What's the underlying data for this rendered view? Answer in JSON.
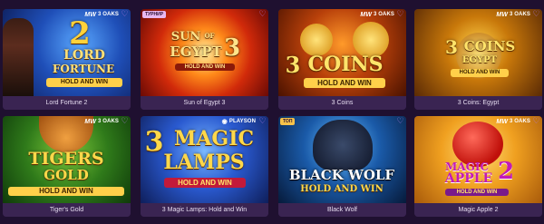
{
  "games": [
    {
      "label": "Lord Fortune 2",
      "logo_lines": [
        "2",
        "LORD",
        "FORTUNE",
        "HOLD AND WIN"
      ],
      "provider": {
        "mark": "MW",
        "name": "3 OAKS",
        "sub": "GAMING"
      },
      "favorite_icon": "heart-icon"
    },
    {
      "label": "Sun of Egypt 3",
      "logo_lines": [
        "SUN",
        "OF",
        "EGYPT",
        "3",
        "HOLD AND WIN"
      ],
      "tag": "ТУРНИР",
      "favorite_icon": "heart-icon"
    },
    {
      "label": "3 Coins",
      "logo_lines": [
        "3",
        "COINS",
        "HOLD AND WIN"
      ],
      "provider": {
        "mark": "MW",
        "name": "3 OAKS",
        "sub": "GAMING"
      },
      "favorite_icon": "heart-icon"
    },
    {
      "label": "3 Coins: Egypt",
      "logo_lines": [
        "3",
        "COINS",
        "EGYPT",
        "HOLD AND WIN"
      ],
      "provider": {
        "mark": "MW",
        "name": "3 OAKS",
        "sub": "GAMING"
      },
      "favorite_icon": "heart-icon"
    },
    {
      "label": "Tiger's Gold",
      "logo_lines": [
        "TIGERS",
        "GOLD",
        "HOLD AND WIN"
      ],
      "provider": {
        "mark": "MW",
        "name": "3 OAKS",
        "sub": "GAMING"
      },
      "favorite_icon": "heart-icon"
    },
    {
      "label": "3 Magic Lamps: Hold and Win",
      "logo_lines": [
        "3",
        "MAGIC",
        "LAMPS",
        "HOLD AND WIN"
      ],
      "provider": {
        "mark": "",
        "name": "PLAYSON",
        "sub": ""
      },
      "favorite_icon": "heart-icon"
    },
    {
      "label": "Black Wolf",
      "logo_lines": [
        "BLACK WOLF",
        "HOLD AND WIN"
      ],
      "tag": "ТОП",
      "favorite_icon": "heart-icon"
    },
    {
      "label": "Magic Apple 2",
      "logo_lines": [
        "MAGIC",
        "APPLE",
        "2",
        "HOLD AND WIN"
      ],
      "provider": {
        "mark": "MW",
        "name": "3 OAKS",
        "sub": "GAMING"
      },
      "favorite_icon": "heart-icon"
    }
  ],
  "colors": {
    "page_bg": "#1f1030",
    "card_label_bg": "#3a2452",
    "favorite": "#b07ae8",
    "tag_tournament": "#e8b8f0",
    "tag_top": "#f6c24a"
  }
}
